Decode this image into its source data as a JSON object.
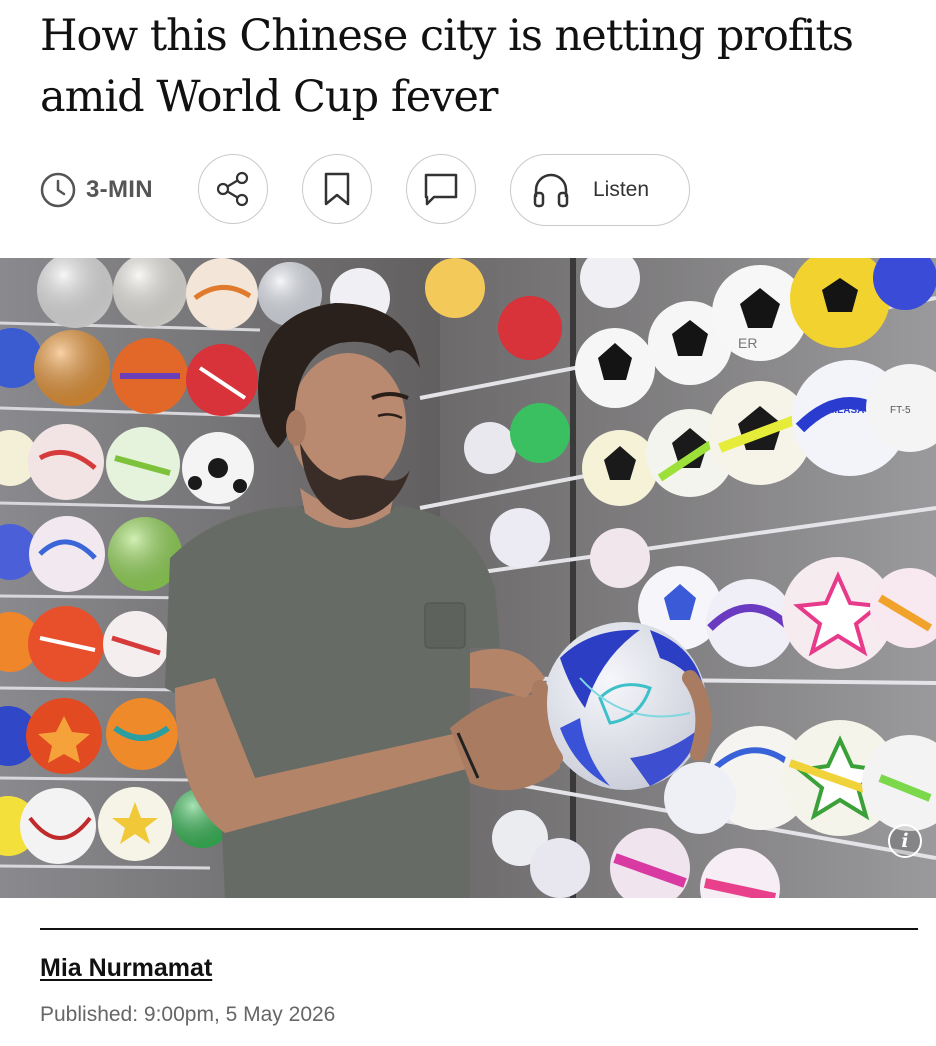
{
  "article": {
    "headline": "How this Chinese city is netting profits amid World Cup fever",
    "read_time": "3-MIN",
    "listen_label": "Listen",
    "author": "Mia Nurmamat",
    "published": "Published: 9:00pm, 5 May 2026"
  },
  "toolbar": {
    "icons": [
      "clock-icon",
      "share-icon",
      "bookmark-icon",
      "comment-icon",
      "headphones-icon"
    ]
  },
  "photo": {
    "info_glyph": "i",
    "ball_prints": [
      "MILASA",
      "FT-5",
      "ER",
      "ER"
    ]
  },
  "colors": {
    "text": "#111111",
    "muted": "#666666",
    "border": "#c9c9c9"
  }
}
